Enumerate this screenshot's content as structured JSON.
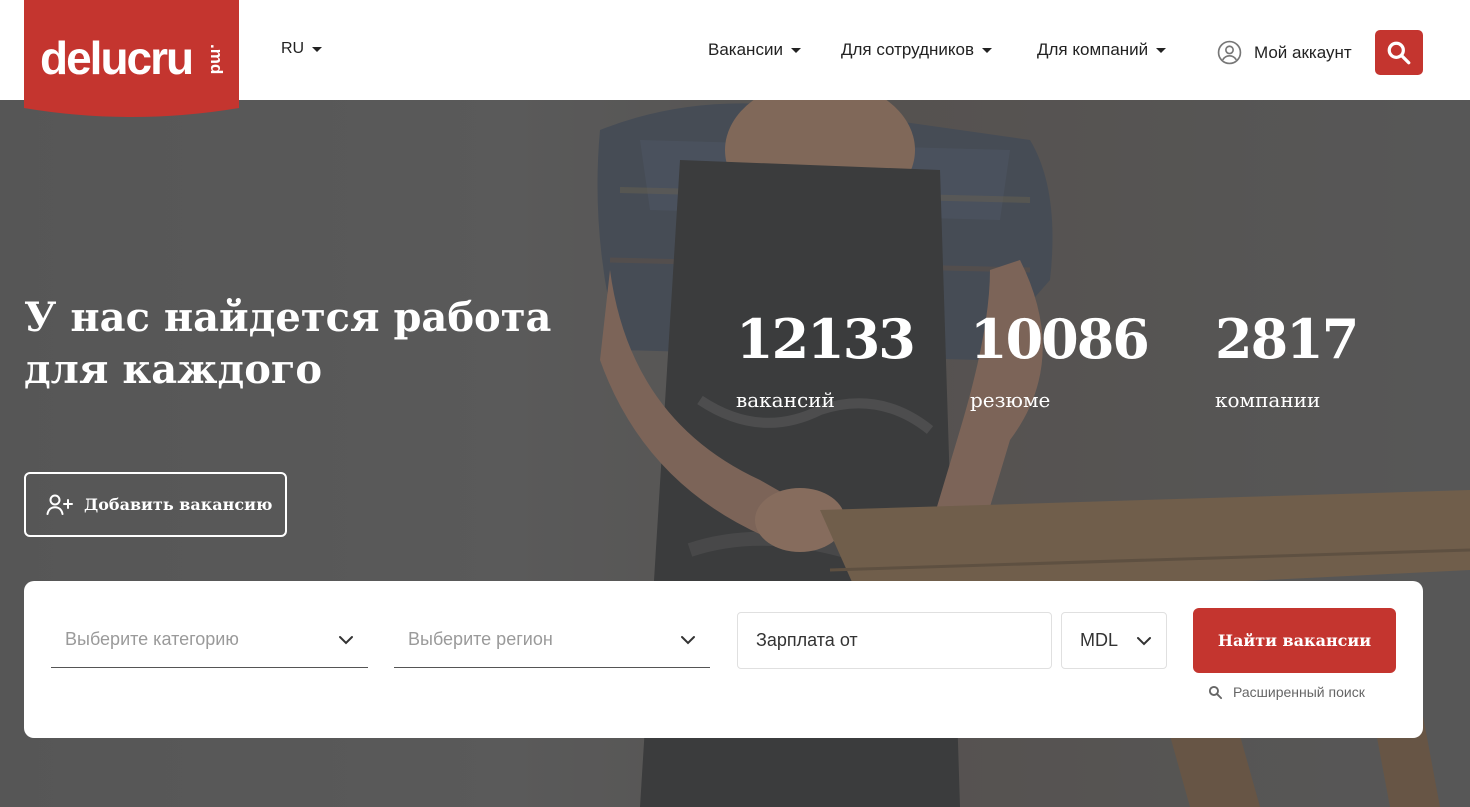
{
  "header": {
    "logo_text": "delucru",
    "logo_suffix": ".md",
    "lang": "RU",
    "nav": [
      {
        "label": "Вакансии"
      },
      {
        "label": "Для сотрудников"
      },
      {
        "label": "Для компаний"
      }
    ],
    "account_label": "Мой аккаунт"
  },
  "hero": {
    "title": "У нас найдется работа для каждого",
    "stats": [
      {
        "value": "12133",
        "label": "вакансий"
      },
      {
        "value": "10086",
        "label": "резюме"
      },
      {
        "value": "2817",
        "label": "компании"
      }
    ],
    "add_vacancy_label": "Добавить вакансию"
  },
  "search": {
    "category_placeholder": "Выберите категорию",
    "region_placeholder": "Выберите регион",
    "salary_placeholder": "Зарплата от",
    "currency": "MDL",
    "submit_label": "Найти вакансии",
    "advanced_label": "Расширенный поиск"
  },
  "colors": {
    "brand": "#c4352f",
    "header_bg": "#ffffff",
    "hero_overlay": "#5e5e5e"
  }
}
